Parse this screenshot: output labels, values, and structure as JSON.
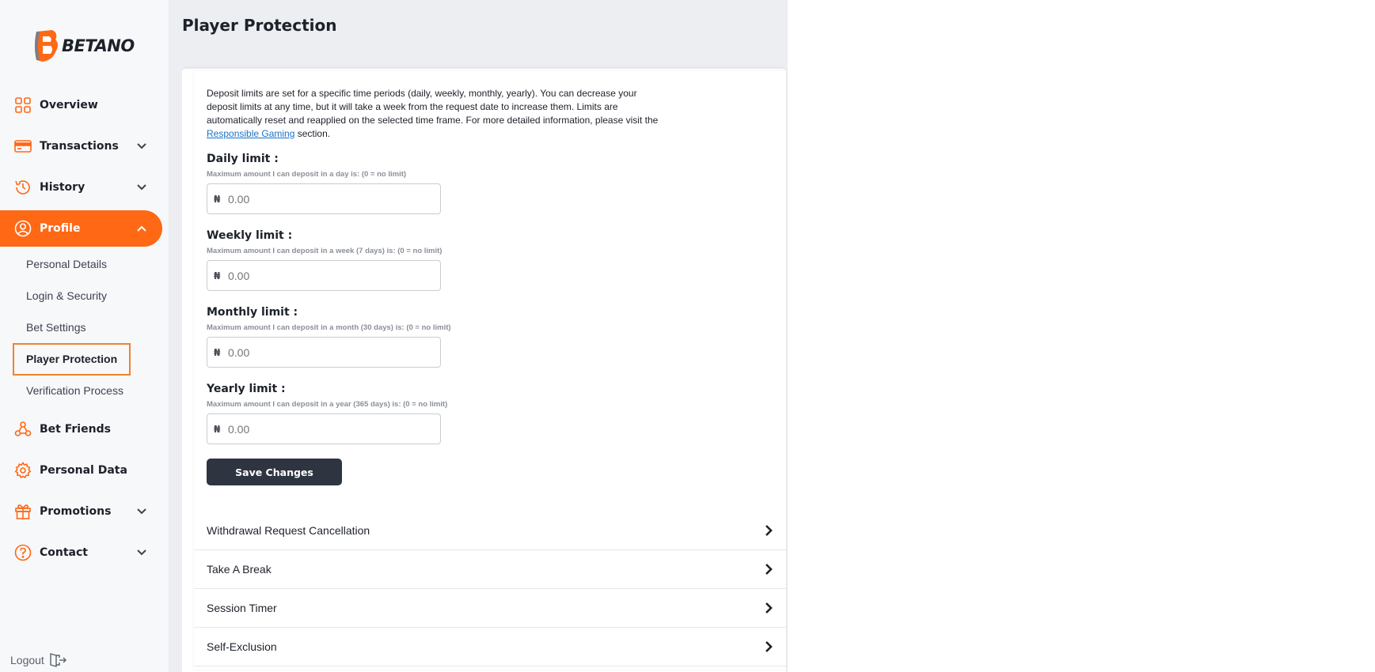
{
  "brand": {
    "name": "BETANO",
    "accent": "#ff6815"
  },
  "sidebar": {
    "items": [
      {
        "label": "Overview",
        "icon": "grid-icon"
      },
      {
        "label": "Transactions",
        "icon": "card-icon"
      },
      {
        "label": "History",
        "icon": "history-icon"
      },
      {
        "label": "Profile",
        "icon": "user-icon"
      },
      {
        "label": "Bet Friends",
        "icon": "friends-icon"
      },
      {
        "label": "Personal Data",
        "icon": "gear-icon"
      },
      {
        "label": "Promotions",
        "icon": "gift-icon"
      },
      {
        "label": "Contact",
        "icon": "help-icon"
      }
    ],
    "profile_sub": [
      "Personal Details",
      "Login & Security",
      "Bet Settings",
      "Player Protection",
      "Verification Process"
    ],
    "logout": "Logout"
  },
  "main": {
    "title": "Player Protection",
    "intro_before": "Deposit limits are set for a specific time periods (daily, weekly, monthly, yearly). You can decrease your deposit limits at any time, but it will take a week from the request date to increase them. Limits are automatically reset and reapplied on the selected time frame. For more detailed information, please visit the ",
    "intro_link": "Responsible Gaming",
    "intro_after": " section.",
    "limits": [
      {
        "title": "Daily limit :",
        "hint": "Maximum amount I can deposit in a day is: (0 = no limit)",
        "currency": "₦",
        "placeholder": "0.00"
      },
      {
        "title": "Weekly limit :",
        "hint": "Maximum amount I can deposit in a week (7 days) is: (0 = no limit)",
        "currency": "₦",
        "placeholder": "0.00"
      },
      {
        "title": "Monthly limit :",
        "hint": "Maximum amount I can deposit in a month (30 days) is: (0 = no limit)",
        "currency": "₦",
        "placeholder": "0.00"
      },
      {
        "title": "Yearly limit :",
        "hint": "Maximum amount I can deposit in a year (365 days) is: (0 = no limit)",
        "currency": "₦",
        "placeholder": "0.00"
      }
    ],
    "save_label": "Save Changes",
    "accordions": [
      "Withdrawal Request Cancellation",
      "Take A Break",
      "Session Timer",
      "Self-Exclusion"
    ]
  }
}
